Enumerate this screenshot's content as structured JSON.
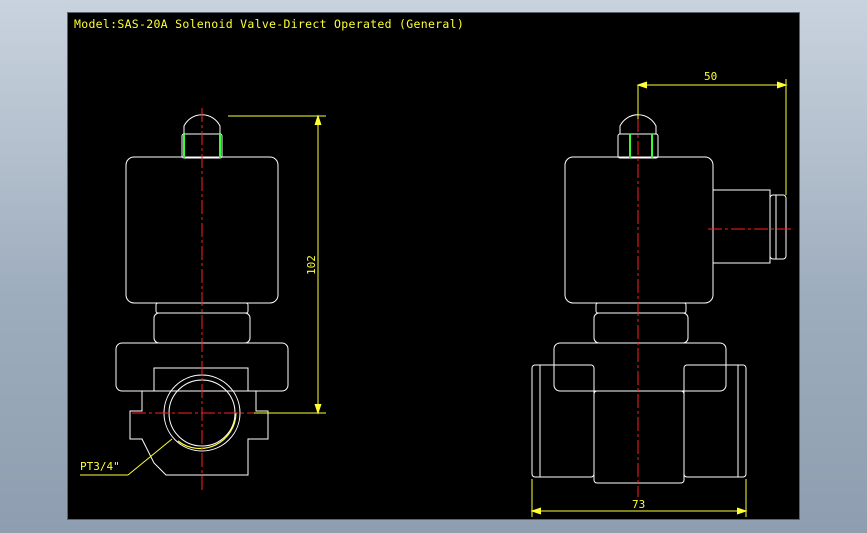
{
  "title": "Model:SAS-20A Solenoid Valve-Direct Operated (General)",
  "dimensions": {
    "height": "102",
    "width_side": "50",
    "width_body": "73"
  },
  "port_label": "PT3/4\"",
  "colors": {
    "outline": "#ffffff",
    "dimension": "#ffff33",
    "centerline": "#ff2020",
    "accent": "#33ff33",
    "background": "#000000"
  }
}
